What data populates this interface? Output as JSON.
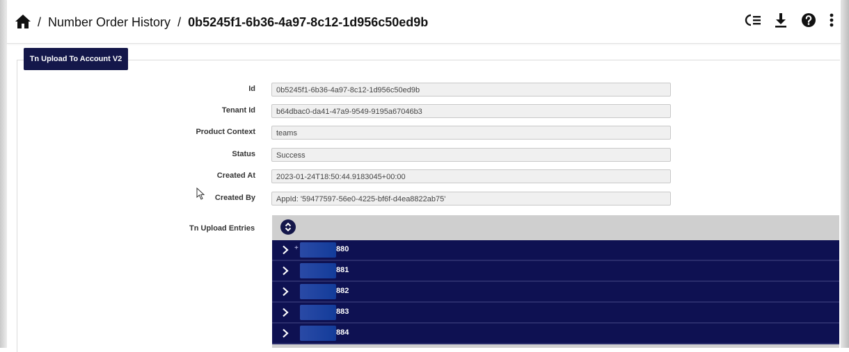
{
  "breadcrumb": {
    "separator": "/",
    "parent": "Number Order History",
    "current": "0b5245f1-6b36-4a97-8c12-1d956c50ed9b"
  },
  "toolbar_icons": [
    "home-icon",
    "list-settings-icon",
    "download-icon",
    "help-icon",
    "more-vert-icon"
  ],
  "tab": {
    "label": "Tn Upload To Account V2"
  },
  "fields": [
    {
      "label": "Id",
      "value": "0b5245f1-6b36-4a97-8c12-1d956c50ed9b"
    },
    {
      "label": "Tenant Id",
      "value": "b64dbac0-da41-47a9-9549-9195a67046b3"
    },
    {
      "label": "Product Context",
      "value": "teams"
    },
    {
      "label": "Status",
      "value": "Success"
    },
    {
      "label": "Created At",
      "value": "2023-01-24T18:50:44.9183045+00:00"
    },
    {
      "label": "Created By",
      "value": "AppId: '59477597-56e0-4225-bf6f-d4ea8822ab75'"
    }
  ],
  "entries": {
    "label": "Tn Upload Entries",
    "items": [
      {
        "prefix": "+",
        "suffix": "880"
      },
      {
        "prefix": "",
        "suffix": "881"
      },
      {
        "prefix": "",
        "suffix": "882"
      },
      {
        "prefix": "",
        "suffix": "883"
      },
      {
        "prefix": "",
        "suffix": "884"
      }
    ]
  },
  "colors": {
    "accent": "#14174a",
    "entry_bg": "#0e1152",
    "redaction": "#1f45a3",
    "field_bg": "#f0f0f0"
  }
}
